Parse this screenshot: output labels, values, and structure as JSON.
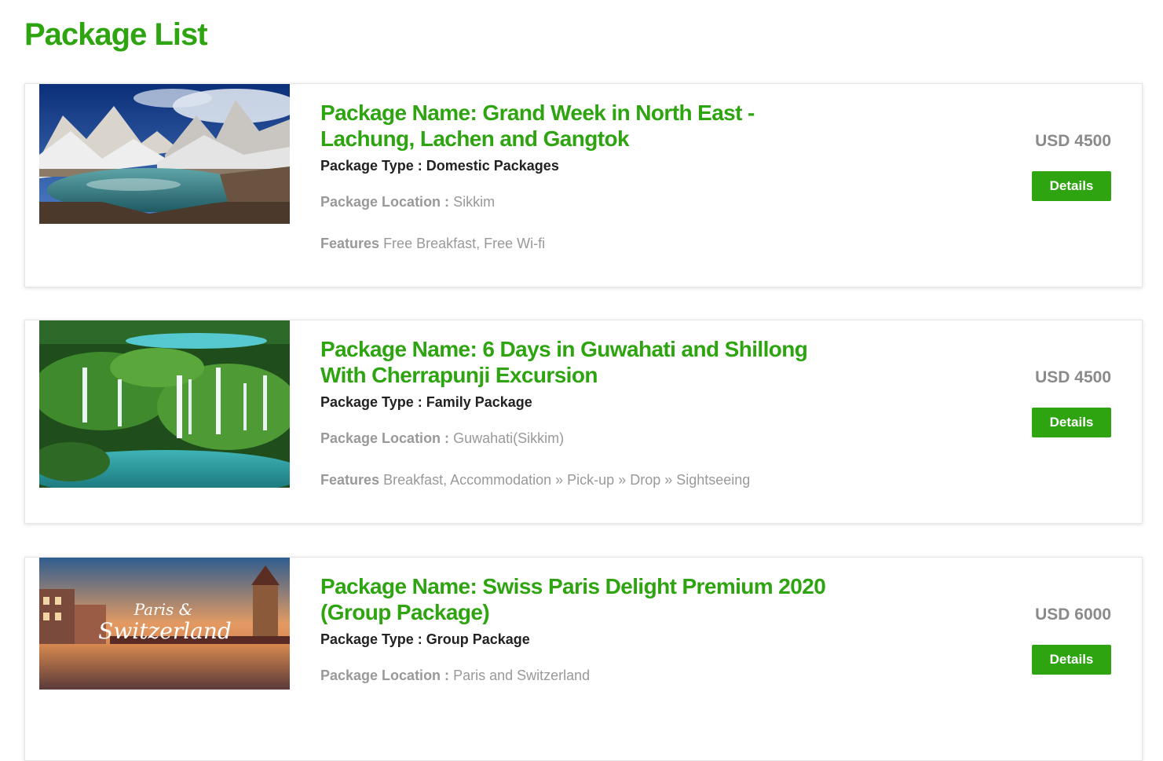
{
  "page": {
    "title": "Package List"
  },
  "labels": {
    "type_label": "Package Type : ",
    "location_label": "Package Location : ",
    "features_label": "Features",
    "details_button": "Details"
  },
  "packages": [
    {
      "name": "Package Name: Grand Week in North East - Lachung, Lachen and Gangtok",
      "type": "Domestic Packages",
      "location": "Sikkim",
      "features": "Free Breakfast, Free Wi-fi",
      "price": "USD 4500",
      "image": "snowy-mountain-lake-image"
    },
    {
      "name": "Package Name: 6 Days in Guwahati and Shillong With Cherrapunji Excursion",
      "type": "Family Package",
      "location": "Guwahati(Sikkim)",
      "features": "Breakfast, Accommodation » Pick-up » Drop » Sightseeing",
      "price": "USD 4500",
      "image": "waterfalls-forest-image"
    },
    {
      "name": "Package Name: Swiss Paris Delight Premium 2020 (Group Package)",
      "type": "Group Package",
      "location": "Paris and Switzerland",
      "price": "USD 6000",
      "image": "paris-switzerland-image",
      "image_caption_1": "Paris &",
      "image_caption_2": "Switzerland"
    }
  ],
  "colors": {
    "accent": "#2ea411",
    "muted": "#999999",
    "price": "#8a8a8a"
  }
}
